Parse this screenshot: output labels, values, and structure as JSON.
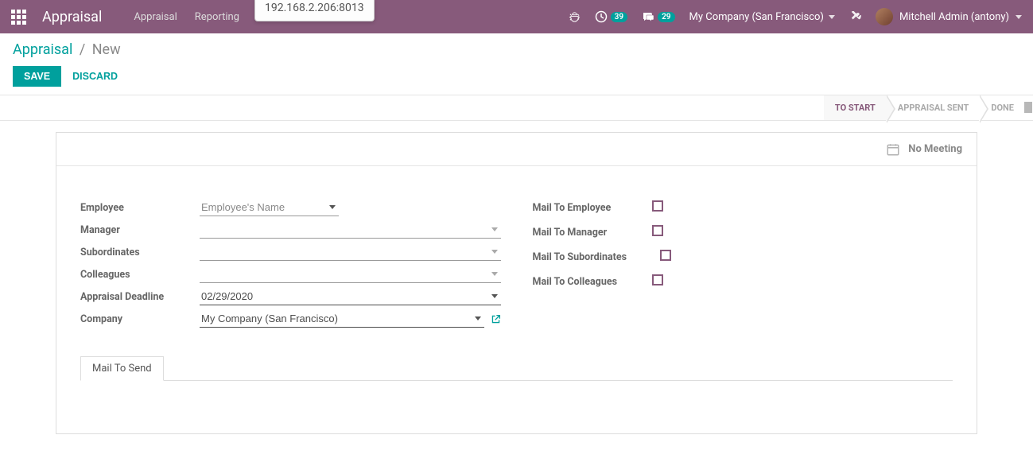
{
  "topbar": {
    "brand": "Appraisal",
    "nav": {
      "appraisal": "Appraisal",
      "reporting": "Reporting"
    },
    "ip_tooltip": "192.168.2.206:8013",
    "activities_count": "39",
    "messages_count": "29",
    "company": "My Company (San Francisco)",
    "user": "Mitchell Admin (antony)"
  },
  "breadcrumb": {
    "root": "Appraisal",
    "current": "New"
  },
  "buttons": {
    "save": "SAVE",
    "discard": "DISCARD"
  },
  "status": {
    "to_start": "TO START",
    "appraisal_sent": "APPRAISAL SENT",
    "done": "DONE"
  },
  "sheet": {
    "no_meeting": "No Meeting",
    "labels": {
      "employee": "Employee",
      "manager": "Manager",
      "subordinates": "Subordinates",
      "colleagues": "Colleagues",
      "deadline": "Appraisal Deadline",
      "company": "Company",
      "mail_employee": "Mail To Employee",
      "mail_manager": "Mail To Manager",
      "mail_subordinates": "Mail To Subordinates",
      "mail_colleagues": "Mail To Colleagues"
    },
    "values": {
      "employee_placeholder": "Employee's Name",
      "manager": "",
      "subordinates": "",
      "colleagues": "",
      "deadline": "02/29/2020",
      "company": "My Company (San Francisco)"
    },
    "tabs": {
      "mail_to_send": "Mail To Send"
    }
  }
}
